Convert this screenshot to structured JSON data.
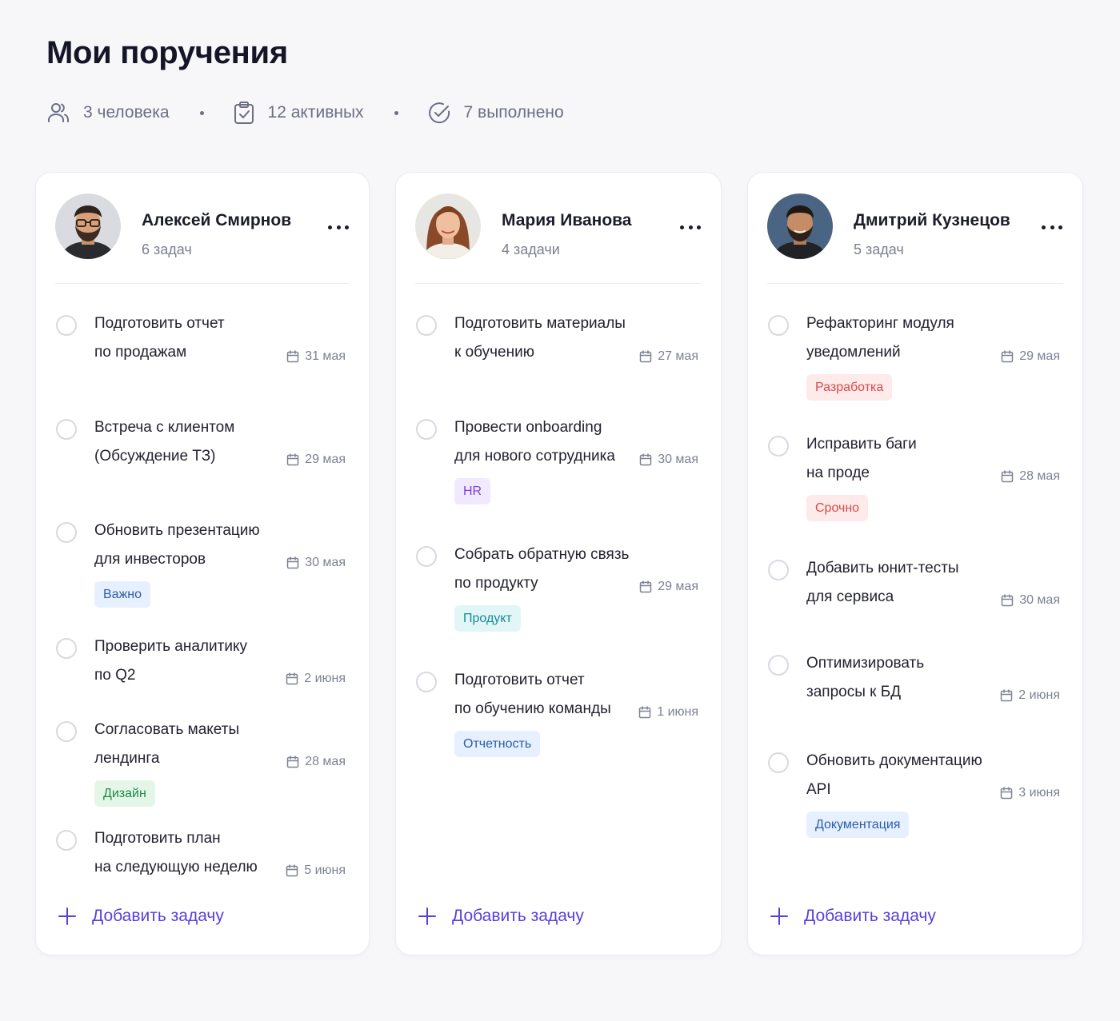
{
  "page": {
    "title": "Мои поручения"
  },
  "stats": {
    "people": "3 человека",
    "active": "12 активных",
    "done": "7 выполнено",
    "icons": [
      "users-icon",
      "clipboard-check-icon",
      "circle-check-icon"
    ]
  },
  "colors": {
    "accent": "#5b3fdb",
    "background": "#f7f7fa",
    "card": "#ffffff",
    "tag_blue_bg": "#e6f0ff",
    "tag_blue_text": "#2c5ea8",
    "tag_green_bg": "#e3f6e8",
    "tag_green_text": "#1f8a44",
    "tag_purple_bg": "#f1e9ff",
    "tag_purple_text": "#7a3fe0",
    "tag_cyan_bg": "#e2f6f8",
    "tag_cyan_text": "#138a99",
    "tag_red_bg": "#fdeaea",
    "tag_red_text": "#d94a4a"
  },
  "add_task_label": "Добавить задачу",
  "columns": [
    {
      "name": "Алексей Смирнов",
      "count": "6 задач",
      "tasks": [
        {
          "line1": "Подготовить отчет",
          "line2": "по продажам",
          "due": "31 мая",
          "tag": null
        },
        {
          "line1": "Встреча с клиентом",
          "line2": "(Обсуждение ТЗ)",
          "due": "29 мая",
          "tag": null
        },
        {
          "line1": "Обновить презентацию",
          "line2": "для инвесторов",
          "due": "30 мая",
          "tag": "Важно"
        },
        {
          "line1": "Проверить аналитику",
          "line2": "по Q2",
          "due": "2 июня",
          "tag": null
        },
        {
          "line1": "Согласовать макеты",
          "line2": "лендинга",
          "due": "28 мая",
          "tag": "Дизайн"
        },
        {
          "line1": "Подготовить план",
          "line2": "на следующую неделю",
          "due": "5 июня",
          "tag": null
        }
      ]
    },
    {
      "name": "Мария Иванова",
      "count": "4 задачи",
      "tasks": [
        {
          "line1": "Подготовить материалы",
          "line2": "к обучению",
          "due": "27 мая",
          "tag": null
        },
        {
          "line1": "Провести onboarding",
          "line2": "для нового сотрудника",
          "due": "30 мая",
          "tag": "HR"
        },
        {
          "line1": "Собрать обратную связь",
          "line2": "по продукту",
          "due": "29 мая",
          "tag": "Продукт"
        },
        {
          "line1": "Подготовить отчет",
          "line2": "по обучению команды",
          "due": "1 июня",
          "tag": "Отчетность"
        }
      ]
    },
    {
      "name": "Дмитрий Кузнецов",
      "count": "5 задач",
      "tasks": [
        {
          "line1": "Рефакторинг модуля",
          "line2": "уведомлений",
          "due": "29 мая",
          "tag": "Разработка"
        },
        {
          "line1": "Исправить баги",
          "line2": "на проде",
          "due": "28 мая",
          "tag": "Срочно"
        },
        {
          "line1": "Добавить юнит-тесты",
          "line2": "для сервиса",
          "due": "30 мая",
          "tag": null
        },
        {
          "line1": "Оптимизировать",
          "line2": "запросы к БД",
          "due": "2 июня",
          "tag": null
        },
        {
          "line1": "Обновить документацию",
          "line2": "API",
          "due": "3 июня",
          "tag": "Документация"
        }
      ]
    }
  ]
}
